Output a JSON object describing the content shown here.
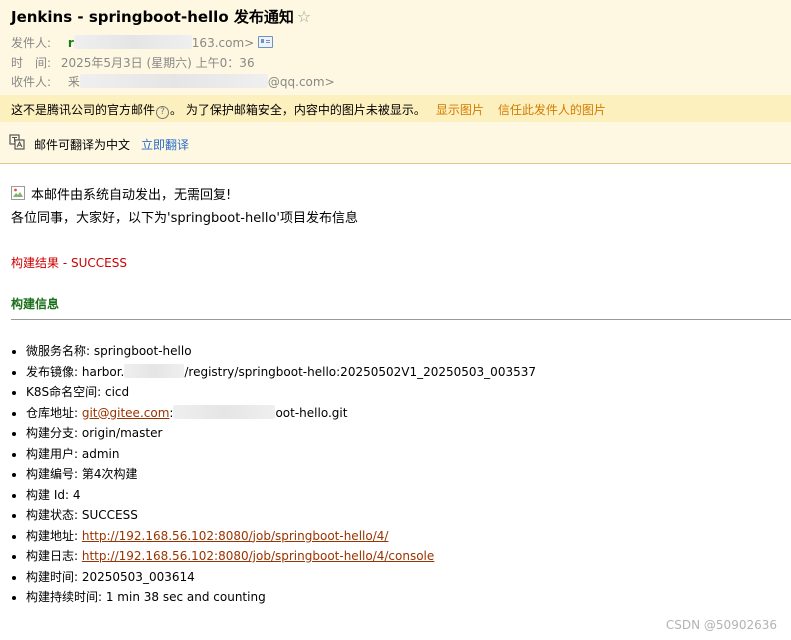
{
  "mail": {
    "subject": "Jenkins - springboot-hello 发布通知",
    "star_glyph": "☆",
    "from_label": "发件人:",
    "from_prefix": "r",
    "from_suffix": "163.com>",
    "time_label": "时　间:",
    "time_value": "2025年5月3日 (星期六) 上午0：36",
    "to_label": "收件人:",
    "to_prefix": "釆",
    "to_suffix": "@qq.com>"
  },
  "warning": {
    "text_1": "这不是腾讯公司的官方邮件",
    "help_glyph": "?",
    "text_2": "。 为了保护邮箱安全，内容中的图片未被显示。",
    "show_images": "显示图片",
    "trust_sender": "信任此发件人的图片"
  },
  "translate": {
    "label": "邮件可翻译为中文",
    "action": "立即翻译"
  },
  "content": {
    "auto_notice": "本邮件由系统自动发出，无需回复!",
    "greeting": "各位同事，大家好，以下为'springboot-hello'项目发布信息",
    "build_result": "构建结果 - SUCCESS",
    "build_info": "构建信息",
    "details": [
      {
        "label": "微服务名称: ",
        "value": "springboot-hello"
      },
      {
        "label": "发布镜像: ",
        "value_prefix": "harbor.",
        "value_suffix": "/registry/springboot-hello:20250502V1_20250503_003537"
      },
      {
        "label": "K8S命名空间: ",
        "value": "cicd"
      },
      {
        "label": "仓库地址: ",
        "link": "git@gitee.com",
        "value_prefix": ":",
        "value_suffix": "oot-hello.git"
      },
      {
        "label": "构建分支: ",
        "value": "origin/master"
      },
      {
        "label": "构建用户: ",
        "value": "admin"
      },
      {
        "label": "构建编号: ",
        "value": "第4次构建"
      },
      {
        "label": "构建 Id: ",
        "value": "4"
      },
      {
        "label": "构建状态: ",
        "value": "SUCCESS"
      },
      {
        "label": "构建地址: ",
        "link": "http://192.168.56.102:8080/job/springboot-hello/4/"
      },
      {
        "label": "构建日志: ",
        "link": "http://192.168.56.102:8080/job/springboot-hello/4/console"
      },
      {
        "label": "构建时间: ",
        "value": "20250503_003614"
      },
      {
        "label": "构建持续时间: ",
        "value": "1 min 38 sec and counting"
      }
    ]
  },
  "watermark": "CSDN @50902636"
}
